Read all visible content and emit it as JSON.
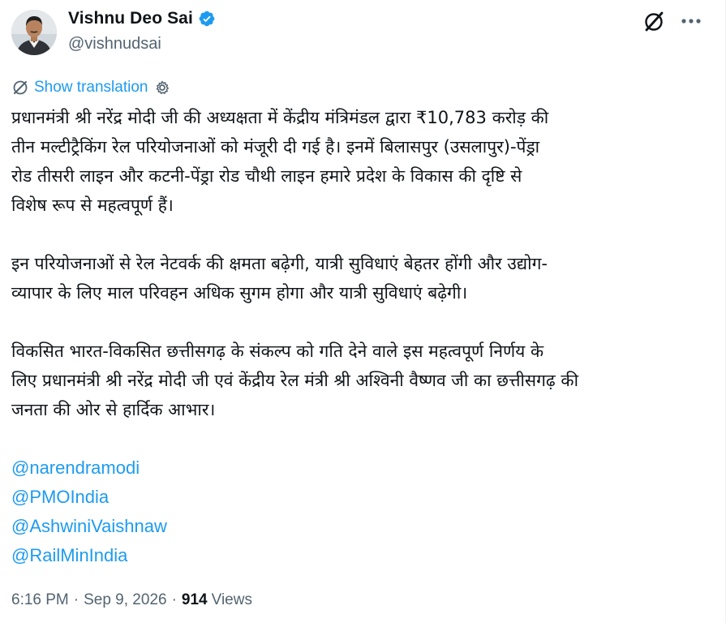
{
  "author": {
    "name": "Vishnu Deo Sai",
    "handle": "@vishnudsai",
    "verified": true,
    "verified_color": "#1d9bf0"
  },
  "header_icons": [
    "grok-icon",
    "more-icon"
  ],
  "translation": {
    "label": "Show translation",
    "icons": [
      "globe-translate-icon",
      "settings-gear-icon"
    ]
  },
  "tweet": {
    "paragraphs": [
      "प्रधानमंत्री श्री नरेंद्र मोदी जी की अध्यक्षता में केंद्रीय मंत्रिमंडल द्वारा ₹10,783 करोड़ की\nतीन मल्टीट्रैकिंग रेल परियोजनाओं को मंजूरी दी गई है। इनमें बिलासपुर (उसलापुर)-पेंड्रा\nरोड तीसरी लाइन और कटनी-पेंड्रा रोड चौथी लाइन हमारे प्रदेश के विकास की दृष्टि से\nविशेष रूप से महत्वपूर्ण हैं।",
      "इन परियोजनाओं से रेल नेटवर्क की क्षमता बढ़ेगी, यात्री सुविधाएं बेहतर होंगी और उद्योग-\nव्यापार के लिए माल परिवहन अधिक सुगम होगा और यात्री सुविधाएं बढ़ेगी।",
      "विकसित भारत-विकसित छत्तीसगढ़ के संकल्प को गति देने वाले इस महत्वपूर्ण निर्णय के\nलिए प्रधानमंत्री श्री नरेंद्र मोदी जी एवं केंद्रीय रेल मंत्री श्री अश्विनी वैष्णव जी का छत्तीसगढ़ की\nजनता की ओर से हार्दिक आभार।"
    ],
    "mentions": [
      "@narendramodi",
      "@PMOIndia",
      "@AshwiniVaishnaw",
      "@RailMinIndia"
    ]
  },
  "meta": {
    "time": "6:16 PM",
    "separator": "·",
    "date": "Sep 9, 2026",
    "views_count": "914",
    "views_label": "Views"
  },
  "colors": {
    "text": "#0f1419",
    "secondary": "#536471",
    "link": "#1d9bf0"
  }
}
